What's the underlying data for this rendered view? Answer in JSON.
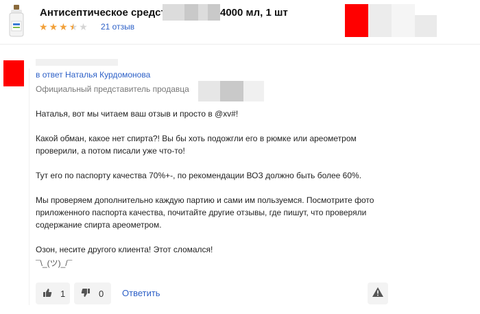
{
  "product": {
    "title_start": "Антисептическое средство",
    "title_end": "4000 мл, 1 шт",
    "rating": 3.5,
    "rating_max": 5,
    "reviews_count": "21 отзыв"
  },
  "reply": {
    "reply_to_prefix": "в ответ",
    "reply_to_name": "Наталья Курдомонова",
    "author_role": "Официальный представитель продавца",
    "paragraphs": [
      "Наталья, вот мы читаем ваш отзыв и просто в @xv#!",
      "Какой обман, какое нет спирта?! Вы бы хоть подожгли его в рюмке или ареометром проверили, а потом писали уже что-то!",
      "Тут его по паспорту качества 70%+-, по рекомендации ВОЗ должно быть более 60%.",
      "Мы проверяем дополнительно каждую партию и сами им пользуемся. Посмотрите фото приложенного паспорта качества, почитайте другие отзывы, где пишут, что проверяли содержание спирта ареометром.",
      "Озон, несите другого клиента! Этот сломался!"
    ],
    "shrug": "¯\\_(ツ)_/¯"
  },
  "actions": {
    "likes": "1",
    "dislikes": "0",
    "answer_label": "Ответить"
  },
  "colors": {
    "link": "#2b5fc7",
    "star": "#f2a13a",
    "censor_red": "#ff0000"
  }
}
